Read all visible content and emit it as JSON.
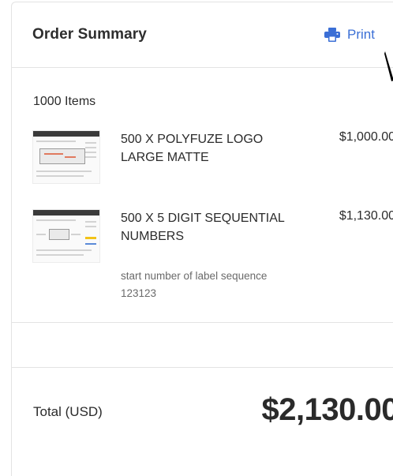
{
  "header": {
    "title": "Order Summary",
    "print_label": "Print"
  },
  "items_count": "1000 Items",
  "items": [
    {
      "name": "500 x POLYFUZE LOGO LARGE MATTE",
      "price": "$1,000.00",
      "note": ""
    },
    {
      "name": "500 x 5 DIGIT SEQUENTIAL NUMBERS",
      "price": "$1,130.00",
      "note": "start number of label sequence 123123"
    }
  ],
  "total": {
    "label": "Total (USD)",
    "value": "$2,130.00"
  },
  "colors": {
    "accent": "#3b6fd6",
    "border": "#e3e3e3"
  },
  "icons": {
    "print": "printer-icon",
    "cursor": "mouse-pointer-icon"
  }
}
